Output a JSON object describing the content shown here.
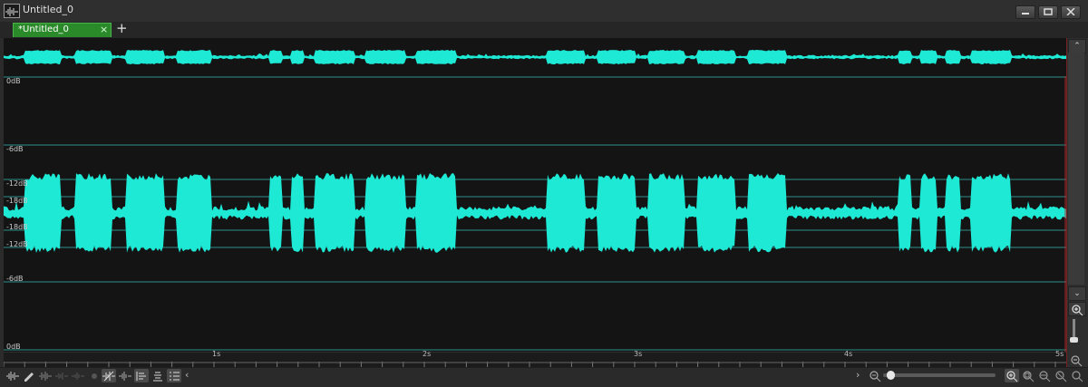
{
  "window": {
    "title": "Untitled_0"
  },
  "tabs": [
    {
      "label": "*Untitled_0",
      "close": "×",
      "active": true
    }
  ],
  "tab_add": "+",
  "waveform": {
    "color": "#1de9d5",
    "db_labels": [
      "0dB",
      "-6dB",
      "-12dB",
      "-18dB",
      "-18dB",
      "-12dB",
      "-6dB",
      "0dB"
    ],
    "segments": [
      {
        "start": 0.0,
        "end": 0.1,
        "level": 0.15
      },
      {
        "start": 0.1,
        "end": 0.27,
        "level": 1.0
      },
      {
        "start": 0.27,
        "end": 0.34,
        "level": 0.15
      },
      {
        "start": 0.34,
        "end": 0.51,
        "level": 1.0
      },
      {
        "start": 0.51,
        "end": 0.58,
        "level": 0.15
      },
      {
        "start": 0.58,
        "end": 0.76,
        "level": 1.0
      },
      {
        "start": 0.76,
        "end": 0.82,
        "level": 0.15
      },
      {
        "start": 0.82,
        "end": 0.99,
        "level": 1.0
      },
      {
        "start": 0.99,
        "end": 1.26,
        "level": 0.18
      },
      {
        "start": 1.26,
        "end": 1.32,
        "level": 0.95
      },
      {
        "start": 1.32,
        "end": 1.37,
        "level": 0.15
      },
      {
        "start": 1.37,
        "end": 1.43,
        "level": 0.95
      },
      {
        "start": 1.43,
        "end": 1.48,
        "level": 0.15
      },
      {
        "start": 1.48,
        "end": 1.67,
        "level": 1.0
      },
      {
        "start": 1.67,
        "end": 1.72,
        "level": 0.15
      },
      {
        "start": 1.72,
        "end": 1.91,
        "level": 1.0
      },
      {
        "start": 1.91,
        "end": 1.96,
        "level": 0.15
      },
      {
        "start": 1.96,
        "end": 2.15,
        "level": 1.0
      },
      {
        "start": 2.15,
        "end": 2.58,
        "level": 0.18
      },
      {
        "start": 2.58,
        "end": 2.76,
        "level": 1.0
      },
      {
        "start": 2.76,
        "end": 2.82,
        "level": 0.15
      },
      {
        "start": 2.82,
        "end": 3.0,
        "level": 1.0
      },
      {
        "start": 3.0,
        "end": 3.06,
        "level": 0.15
      },
      {
        "start": 3.06,
        "end": 3.24,
        "level": 1.0
      },
      {
        "start": 3.24,
        "end": 3.3,
        "level": 0.15
      },
      {
        "start": 3.3,
        "end": 3.48,
        "level": 1.0
      },
      {
        "start": 3.48,
        "end": 3.54,
        "level": 0.15
      },
      {
        "start": 3.54,
        "end": 3.72,
        "level": 1.0
      },
      {
        "start": 3.72,
        "end": 4.25,
        "level": 0.18
      },
      {
        "start": 4.25,
        "end": 4.31,
        "level": 0.95
      },
      {
        "start": 4.31,
        "end": 4.36,
        "level": 0.15
      },
      {
        "start": 4.36,
        "end": 4.43,
        "level": 0.95
      },
      {
        "start": 4.43,
        "end": 4.48,
        "level": 0.15
      },
      {
        "start": 4.48,
        "end": 4.55,
        "level": 0.95
      },
      {
        "start": 4.55,
        "end": 4.6,
        "level": 0.15
      },
      {
        "start": 4.6,
        "end": 4.79,
        "level": 1.0
      },
      {
        "start": 4.79,
        "end": 5.05,
        "level": 0.18
      }
    ],
    "duration_s": 5.05
  },
  "ruler": {
    "ticks": [
      "1s",
      "2s",
      "3s",
      "4s",
      "5s"
    ]
  },
  "toolbar": {
    "collapse": "‹",
    "expand": "›"
  },
  "vscroll": {
    "up": "⌃",
    "down": "⌄"
  }
}
